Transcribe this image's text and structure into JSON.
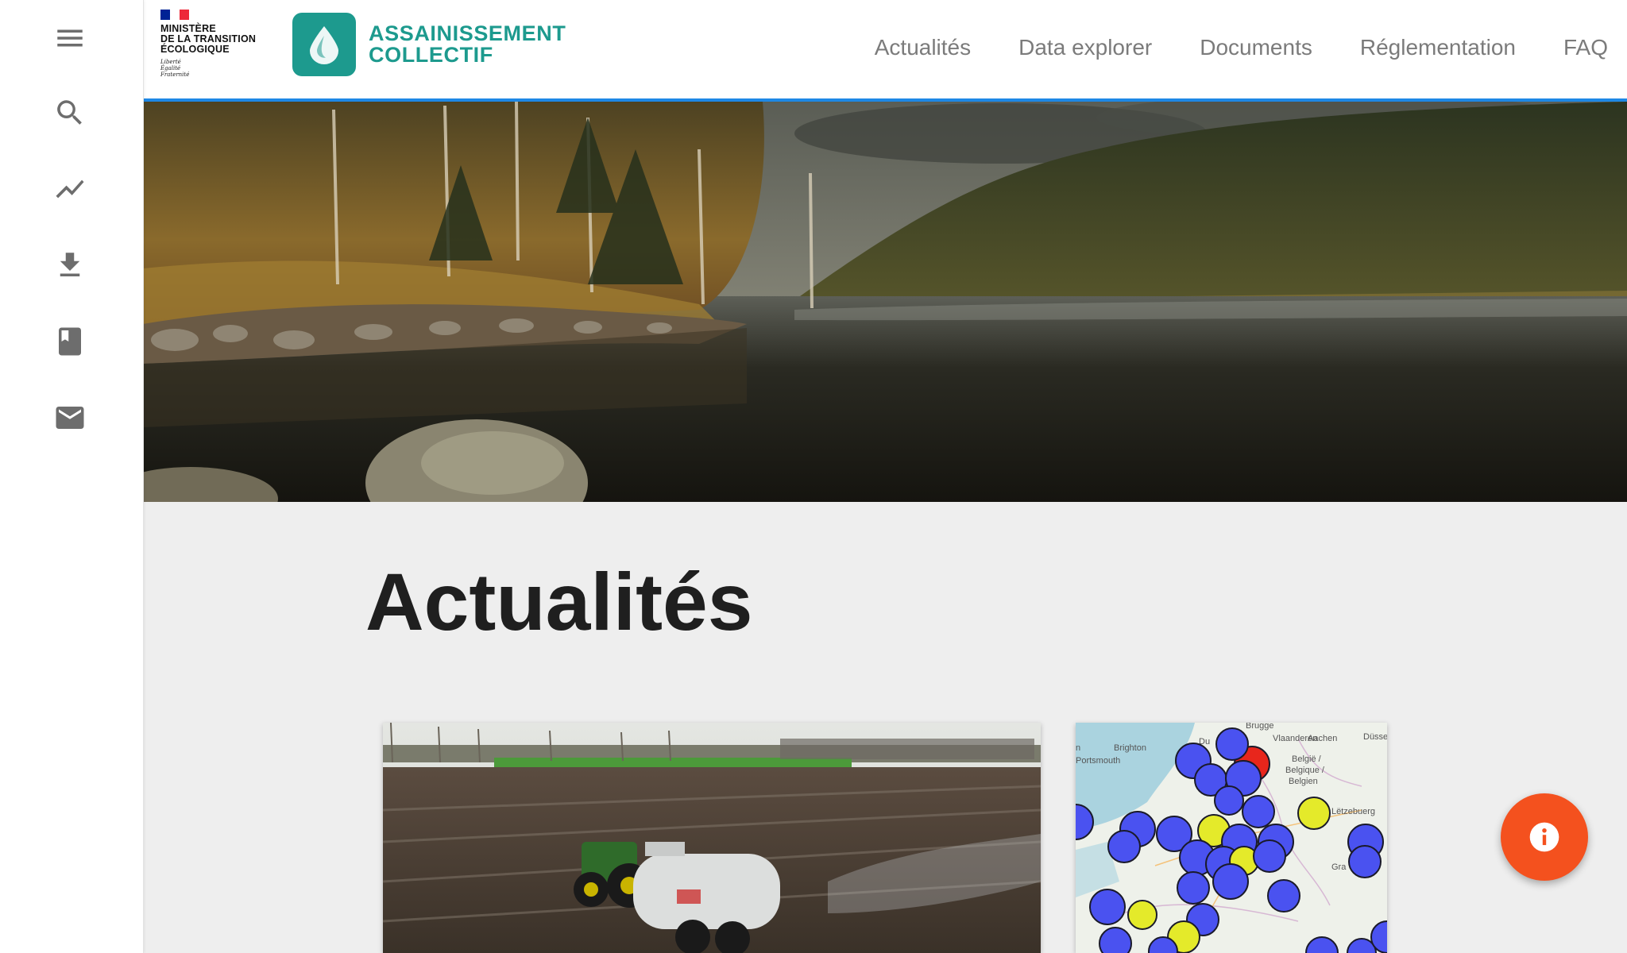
{
  "sidebar": {
    "items": [
      {
        "name": "menu-icon"
      },
      {
        "name": "search-icon"
      },
      {
        "name": "trending-icon"
      },
      {
        "name": "download-icon"
      },
      {
        "name": "book-icon"
      },
      {
        "name": "mail-icon"
      }
    ]
  },
  "header": {
    "gov_logo": {
      "line1": "MINISTÈRE",
      "line2": "DE LA TRANSITION",
      "line3": "ÉCOLOGIQUE",
      "motto1": "Liberté",
      "motto2": "Égalité",
      "motto3": "Fraternité"
    },
    "brand": {
      "line1": "ASSAINISSEMENT",
      "line2": "COLLECTIF",
      "color": "#1d9a8e"
    },
    "nav": [
      {
        "label": "Actualités"
      },
      {
        "label": "Data explorer"
      },
      {
        "label": "Documents"
      },
      {
        "label": "Réglementation"
      },
      {
        "label": "FAQ"
      }
    ],
    "accent": "#1e88e5"
  },
  "main": {
    "title": "Actualités"
  },
  "cards": {
    "map_labels": {
      "brugge": "Brugge",
      "vlaanderen": "Vlaanderen",
      "brighton": "Brighton",
      "portsmouth": "Portsmouth",
      "belgie": "België /",
      "belgique": "Belgique /",
      "belgien": "Belgien",
      "letzebuerg": "Lëtzebuerg",
      "aachen": "Aachen",
      "dusse": "Düsse",
      "du": "Du",
      "gra": "Gra",
      "n": "n"
    }
  },
  "fab": {
    "icon": "info-icon",
    "color": "#f4511e"
  }
}
